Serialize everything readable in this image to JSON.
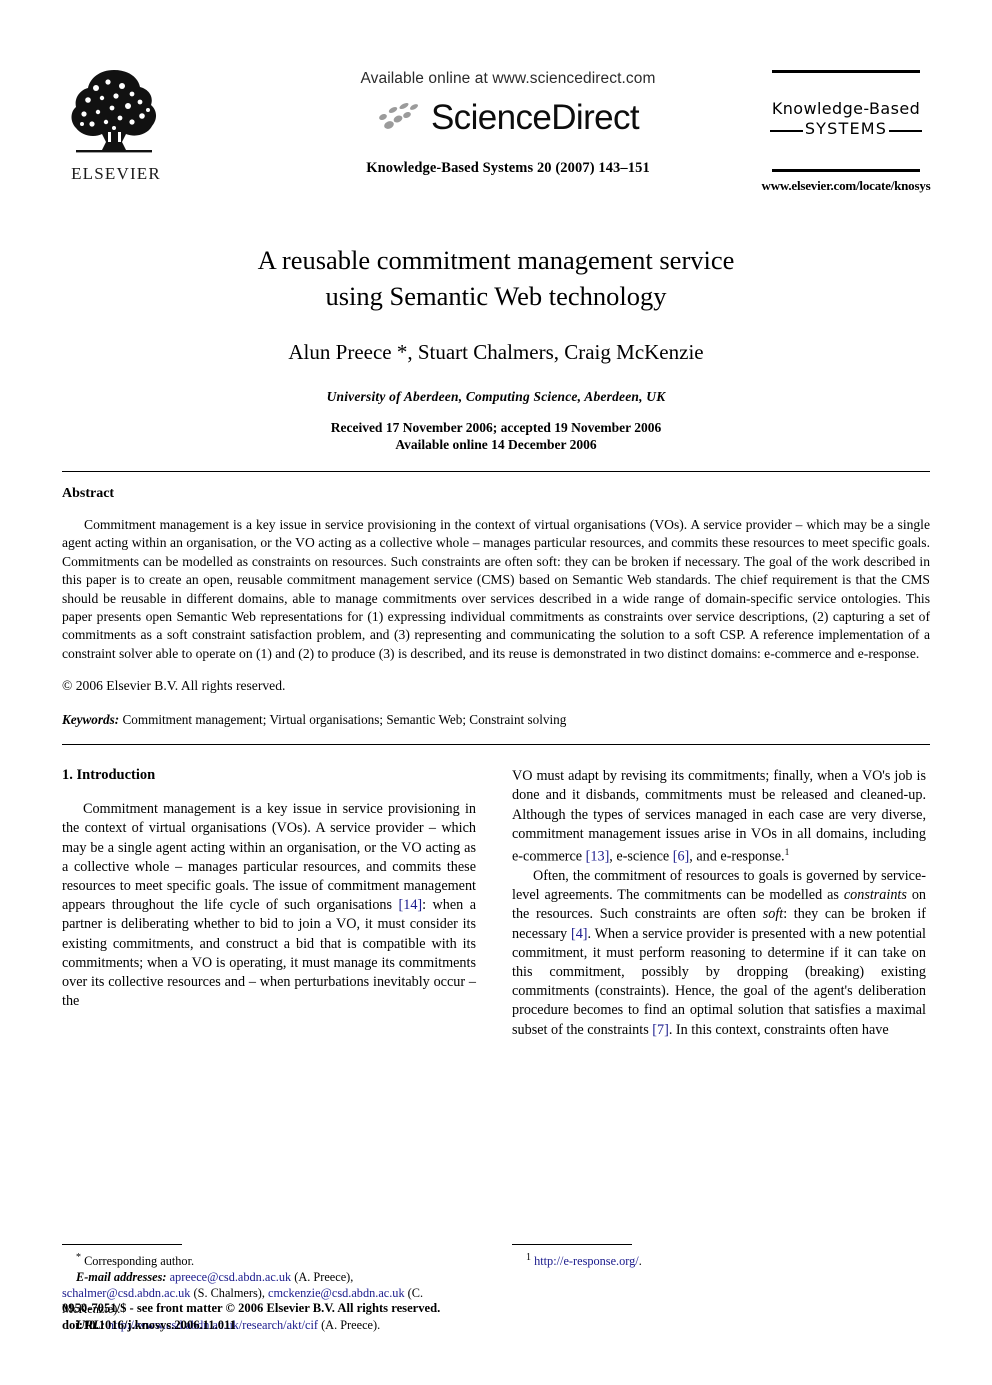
{
  "header": {
    "publisher_name": "ELSEVIER",
    "available_online": "Available online at www.sciencedirect.com",
    "sciencedirect_wordmark": "ScienceDirect",
    "journal_reference": "Knowledge-Based Systems 20 (2007) 143–151",
    "journal_logo_line1": "Knowledge-Based",
    "journal_logo_line2": "SYSTEMS",
    "journal_url": "www.elsevier.com/locate/knosys"
  },
  "article": {
    "title_line1": "A reusable commitment management service",
    "title_line2": "using Semantic Web technology",
    "authors": "Alun Preece *, Stuart Chalmers, Craig McKenzie",
    "affiliation": "University of Aberdeen, Computing Science, Aberdeen, UK",
    "received_line": "Received 17 November 2006; accepted 19 November 2006",
    "available_line": "Available online 14 December 2006"
  },
  "abstract": {
    "heading": "Abstract",
    "body": "Commitment management is a key issue in service provisioning in the context of virtual organisations (VOs). A service provider – which may be a single agent acting within an organisation, or the VO acting as a collective whole – manages particular resources, and commits these resources to meet specific goals. Commitments can be modelled as constraints on resources. Such constraints are often soft: they can be broken if necessary. The goal of the work described in this paper is to create an open, reusable commitment management service (CMS) based on Semantic Web standards. The chief requirement is that the CMS should be reusable in different domains, able to manage commitments over services described in a wide range of domain-specific service ontologies. This paper presents open Semantic Web representations for (1) expressing individual commitments as constraints over service descriptions, (2) capturing a set of commitments as a soft constraint satisfaction problem, and (3) representing and communicating the solution to a soft CSP. A reference implementation of a constraint solver able to operate on (1) and (2) to produce (3) is described, and its reuse is demonstrated in two distinct domains: e-commerce and e-response.",
    "copyright": "© 2006 Elsevier B.V. All rights reserved.",
    "keywords_label": "Keywords:",
    "keywords_value": "Commitment management; Virtual organisations; Semantic Web; Constraint solving"
  },
  "body": {
    "section1_heading": "1. Introduction",
    "left_para1": "Commitment management is a key issue in service provisioning in the context of virtual organisations (VOs). A service provider – which may be a single agent acting within an organisation, or the VO acting as a collective whole – manages particular resources, and commits these resources to meet specific goals. The issue of commitment management appears throughout the life cycle of such organisations ",
    "left_ref_14": "[14]",
    "left_para1_cont": ": when a partner is deliberating whether to bid to join a VO, it must consider its existing commitments, and construct a bid that is compatible with its commitments; when a VO is operating, it must manage its commitments over its collective resources and – when perturbations inevitably occur – the",
    "right_para1": "VO must adapt by revising its commitments; finally, when a VO's job is done and it disbands, commitments must be released and cleaned-up. Although the types of services managed in each case are very diverse, commitment management issues arise in VOs in all domains, including e-commerce ",
    "right_ref_13": "[13]",
    "right_para1_mid": ", e-science ",
    "right_ref_6": "[6]",
    "right_para1_end": ", and e-response.",
    "right_footnote_marker": "1",
    "right_para2_a": "Often, the commitment of resources to goals is governed by service-level agreements. The commitments can be modelled as ",
    "right_italic_constraints": "constraints",
    "right_para2_b": " on the resources. Such constraints are often ",
    "right_italic_soft": "soft",
    "right_para2_c": ": they can be broken if necessary ",
    "right_ref_4": "[4]",
    "right_para2_d": ". When a service provider is presented with a new potential commitment, it must perform reasoning to determine if it can take on this commitment, possibly by dropping (breaking) existing commitments (constraints). Hence, the goal of the agent's deliberation procedure becomes to find an optimal solution that satisfies a maximal subset of the constraints ",
    "right_ref_7": "[7]",
    "right_para2_e": ". In this context, constraints often have"
  },
  "footnotes": {
    "corresponding_marker": "*",
    "corresponding_text": "Corresponding author.",
    "email_label": "E-mail addresses:",
    "email_1": "apreece@csd.abdn.ac.uk",
    "email_1_name": " (A. Preece), ",
    "email_2": "schalmer@csd.abdn.ac.uk",
    "email_2_name": " (S. Chalmers), ",
    "email_3": "cmckenzie@csd.abdn.ac.uk",
    "email_3_name": " (C. McKenzie).",
    "url_label": "URL:",
    "url_value": "http://www.csd.abdn.ac.uk/research/akt/cif",
    "url_name": " (A. Preece).",
    "right_marker": "1",
    "right_url": "http://e-response.org/",
    "right_url_tail": "."
  },
  "imprint": {
    "line1": "0950-7051/$ - see front matter © 2006 Elsevier B.V. All rights reserved.",
    "line2": "doi:10.1016/j.knosys.2006.11.011"
  },
  "colors": {
    "link": "#1a1a8c",
    "text": "#000000",
    "sd_grey": "#9b9b9b"
  }
}
